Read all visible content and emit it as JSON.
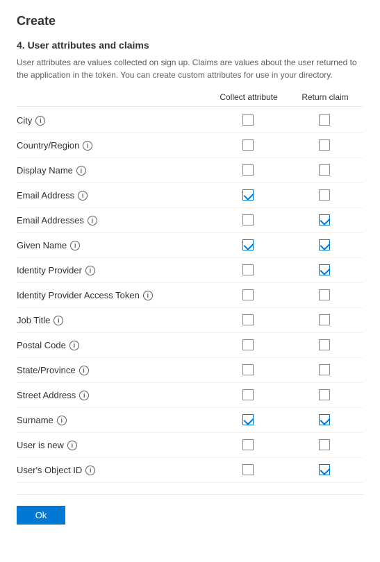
{
  "page": {
    "title": "Create",
    "section_number": "4. User attributes and claims",
    "description": "User attributes are values collected on sign up. Claims are values about the user returned to the application in the token. You can create custom attributes for use in your directory.",
    "col_collect": "Collect attribute",
    "col_return": "Return claim",
    "ok_label": "Ok"
  },
  "attributes": [
    {
      "name": "City",
      "collect": false,
      "return": false
    },
    {
      "name": "Country/Region",
      "collect": false,
      "return": false
    },
    {
      "name": "Display Name",
      "collect": false,
      "return": false
    },
    {
      "name": "Email Address",
      "collect": true,
      "return": false
    },
    {
      "name": "Email Addresses",
      "collect": false,
      "return": true
    },
    {
      "name": "Given Name",
      "collect": true,
      "return": true
    },
    {
      "name": "Identity Provider",
      "collect": false,
      "return": true
    },
    {
      "name": "Identity Provider Access Token",
      "collect": false,
      "return": false
    },
    {
      "name": "Job Title",
      "collect": false,
      "return": false
    },
    {
      "name": "Postal Code",
      "collect": false,
      "return": false
    },
    {
      "name": "State/Province",
      "collect": false,
      "return": false
    },
    {
      "name": "Street Address",
      "collect": false,
      "return": false
    },
    {
      "name": "Surname",
      "collect": true,
      "return": true
    },
    {
      "name": "User is new",
      "collect": false,
      "return": false
    },
    {
      "name": "User's Object ID",
      "collect": false,
      "return": true
    }
  ],
  "icons": {
    "info": "i",
    "checkmark": "✓"
  }
}
